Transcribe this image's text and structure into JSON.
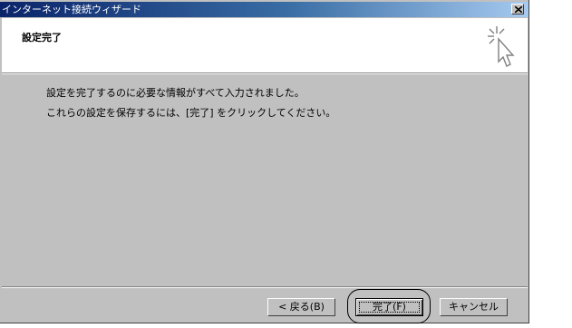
{
  "window": {
    "title": "インターネット接続ウィザード"
  },
  "header": {
    "title": "設定完了",
    "icon": "wizard-click-cursor-icon"
  },
  "body": {
    "line1": "設定を完了するのに必要な情報がすべて入力されました。",
    "line2": "これらの設定を保存するには、[完了] をクリックしてください。"
  },
  "buttons": {
    "back": "< 戻る(B)",
    "finish": "完了(F)",
    "cancel": "キャンセル"
  }
}
